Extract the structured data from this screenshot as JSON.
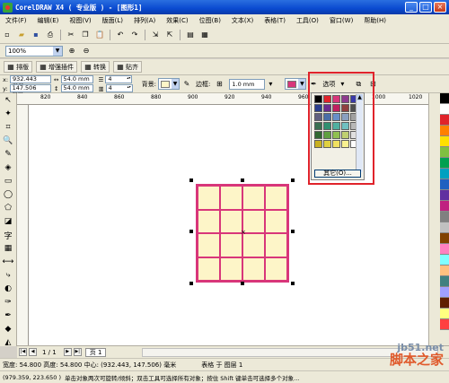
{
  "window": {
    "title": "CorelDRAW X4 ( 专业版 ) - [图形1]"
  },
  "menu": [
    "文件(F)",
    "编辑(E)",
    "视图(V)",
    "版面(L)",
    "排列(A)",
    "效果(C)",
    "位图(B)",
    "文本(X)",
    "表格(T)",
    "工具(O)",
    "窗口(W)",
    "帮助(H)"
  ],
  "zoom": {
    "value": "100%"
  },
  "table_tabs": [
    "排版",
    "增强插件",
    "转换",
    "贴齐"
  ],
  "propbar": {
    "x_label": "x:",
    "x_value": "932.443 mm",
    "y_label": "y:",
    "y_value": "147.506 mm",
    "w_value": "54.0 mm",
    "h_value": "54.0 mm",
    "rows": "4",
    "cols": "4",
    "background_label": "背景:",
    "background_color": "#fdf5c8",
    "border_label": "边框:",
    "border_width": "1.0 mm",
    "border_color": "#d8367a",
    "options_label": "选项"
  },
  "color_picker": {
    "colors": [
      "#000000",
      "#e0232b",
      "#d8367a",
      "#8e3b8e",
      "#3a3aa8",
      "#2b3f8e",
      "#6b2c8e",
      "#c02060",
      "#904040",
      "#505050",
      "#606080",
      "#4a6ea8",
      "#6890c8",
      "#8aa0c0",
      "#a0a0a0",
      "#3a7050",
      "#309070",
      "#50b0a0",
      "#70c0c0",
      "#b8b8b8",
      "#306830",
      "#60a040",
      "#90c050",
      "#c0d070",
      "#e0e0e0",
      "#c8b020",
      "#e0d040",
      "#f0e060",
      "#f8f090",
      "#ffffff"
    ],
    "other_label": "其它(O)..."
  },
  "ruler": {
    "ticks": [
      "820",
      "840",
      "860",
      "880",
      "900",
      "920",
      "940",
      "960",
      "980",
      "1000",
      "1020"
    ]
  },
  "palette_colors": [
    "#000000",
    "#ffffff",
    "#e0232b",
    "#ff8000",
    "#ffe000",
    "#80c040",
    "#00a050",
    "#00a0c0",
    "#2060c0",
    "#6030a0",
    "#c02080",
    "#808080",
    "#c0c0c0",
    "#804000",
    "#ff80c0",
    "#80ffff",
    "#ffc080",
    "#408080",
    "#a0a0ff",
    "#602000",
    "#ffff80",
    "#ff4040"
  ],
  "pagebar": {
    "page_count": "1 / 1",
    "page_tab": "页 1"
  },
  "status": {
    "size": "宽度: 54.800  高度: 54.800  中心: (932.443, 147.506)  毫米",
    "layer": "表格 于 图层 1",
    "coords": "(979.359, 223.650 )",
    "hint": "单击对象两次可旋转/倾斜；双击工具可选择所有对象；按住 Shift 键单击可选择多个对象..."
  },
  "watermark": {
    "en": "jb51.net",
    "zh": "脚本之家"
  }
}
